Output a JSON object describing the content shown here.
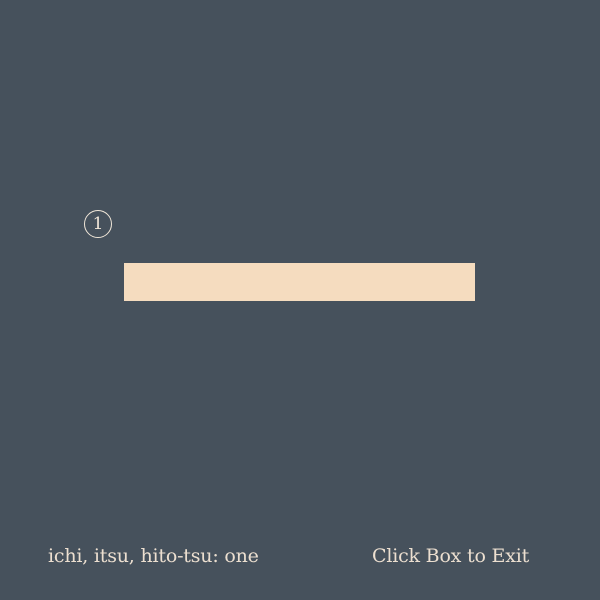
{
  "kanji": {
    "stroke_number": "1",
    "stroke_color": "#f5dcbf"
  },
  "footer": {
    "reading": "ichi, itsu, hito-tsu: one",
    "exit_hint": "Click Box to Exit"
  },
  "colors": {
    "background": "#46515c",
    "text": "#ecdfd0"
  }
}
